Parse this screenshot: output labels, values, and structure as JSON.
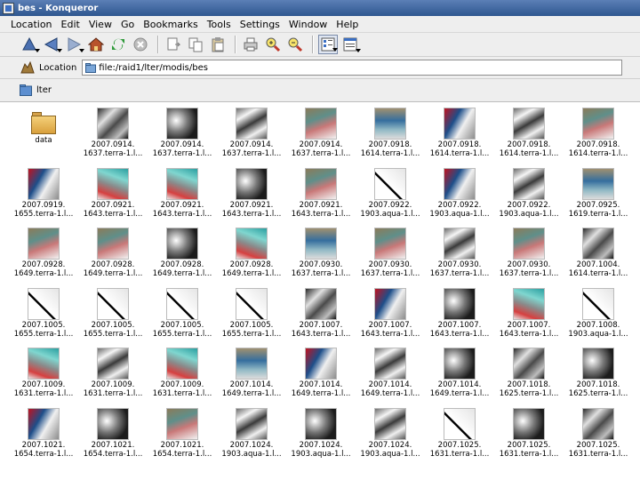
{
  "window": {
    "title": "bes - Konqueror"
  },
  "menu": [
    "Location",
    "Edit",
    "View",
    "Go",
    "Bookmarks",
    "Tools",
    "Settings",
    "Window",
    "Help"
  ],
  "toolbar": {
    "icons": [
      "up-icon",
      "back-icon",
      "forward-icon",
      "home-icon",
      "reload-icon",
      "stop-icon",
      "cut-icon",
      "copy-icon",
      "paste-icon",
      "print-icon",
      "zoom-in-icon",
      "zoom-out-icon",
      "icon-view-icon",
      "detail-view-icon"
    ]
  },
  "location": {
    "label": "Location",
    "url": "file:/raid1/lter/modis/bes"
  },
  "bookmarks": {
    "label": "lter"
  },
  "files": [
    {
      "l1": "data",
      "l2": "",
      "t": "folder"
    },
    {
      "l1": "2007.0914.",
      "l2": "1637.terra-1.l...",
      "t": "t-a"
    },
    {
      "l1": "2007.0914.",
      "l2": "1637.terra-1.l...",
      "t": "t-b"
    },
    {
      "l1": "2007.0914.",
      "l2": "1637.terra-1.l...",
      "t": "t-g"
    },
    {
      "l1": "2007.0914.",
      "l2": "1637.terra-1.l...",
      "t": "t-c"
    },
    {
      "l1": "2007.0918.",
      "l2": "1614.terra-1.l...",
      "t": "t-h"
    },
    {
      "l1": "2007.0918.",
      "l2": "1614.terra-1.l...",
      "t": "t-e"
    },
    {
      "l1": "2007.0918.",
      "l2": "1614.terra-1.l...",
      "t": "t-g"
    },
    {
      "l1": "2007.0918.",
      "l2": "1614.terra-1.l...",
      "t": "t-c"
    },
    {
      "l1": "2007.0919.",
      "l2": "1655.terra-1.l...",
      "t": "t-e"
    },
    {
      "l1": "2007.0921.",
      "l2": "1643.terra-1.l...",
      "t": "t-d"
    },
    {
      "l1": "2007.0921.",
      "l2": "1643.terra-1.l...",
      "t": "t-d"
    },
    {
      "l1": "2007.0921.",
      "l2": "1643.terra-1.l...",
      "t": "t-b"
    },
    {
      "l1": "2007.0921.",
      "l2": "1643.terra-1.l...",
      "t": "t-c"
    },
    {
      "l1": "2007.0922.",
      "l2": "1903.aqua-1.l...",
      "t": "t-f"
    },
    {
      "l1": "2007.0922.",
      "l2": "1903.aqua-1.l...",
      "t": "t-e"
    },
    {
      "l1": "2007.0922.",
      "l2": "1903.aqua-1.l...",
      "t": "t-g"
    },
    {
      "l1": "2007.0925.",
      "l2": "1619.terra-1.l...",
      "t": "t-h"
    },
    {
      "l1": "2007.0928.",
      "l2": "1649.terra-1.l...",
      "t": "t-c"
    },
    {
      "l1": "2007.0928.",
      "l2": "1649.terra-1.l...",
      "t": "t-c"
    },
    {
      "l1": "2007.0928.",
      "l2": "1649.terra-1.l...",
      "t": "t-b"
    },
    {
      "l1": "2007.0928.",
      "l2": "1649.terra-1.l...",
      "t": "t-d"
    },
    {
      "l1": "2007.0930.",
      "l2": "1637.terra-1.l...",
      "t": "t-h"
    },
    {
      "l1": "2007.0930.",
      "l2": "1637.terra-1.l...",
      "t": "t-c"
    },
    {
      "l1": "2007.0930.",
      "l2": "1637.terra-1.l...",
      "t": "t-g"
    },
    {
      "l1": "2007.0930.",
      "l2": "1637.terra-1.l...",
      "t": "t-c"
    },
    {
      "l1": "2007.1004.",
      "l2": "1614.terra-1.l...",
      "t": "t-a"
    },
    {
      "l1": "2007.1005.",
      "l2": "1655.terra-1.l...",
      "t": "t-f"
    },
    {
      "l1": "2007.1005.",
      "l2": "1655.terra-1.l...",
      "t": "t-f"
    },
    {
      "l1": "2007.1005.",
      "l2": "1655.terra-1.l...",
      "t": "t-f"
    },
    {
      "l1": "2007.1005.",
      "l2": "1655.terra-1.l...",
      "t": "t-f"
    },
    {
      "l1": "2007.1007.",
      "l2": "1643.terra-1.l...",
      "t": "t-a"
    },
    {
      "l1": "2007.1007.",
      "l2": "1643.terra-1.l...",
      "t": "t-e"
    },
    {
      "l1": "2007.1007.",
      "l2": "1643.terra-1.l...",
      "t": "t-b"
    },
    {
      "l1": "2007.1007.",
      "l2": "1643.terra-1.l...",
      "t": "t-d"
    },
    {
      "l1": "2007.1008.",
      "l2": "1903.aqua-1.l...",
      "t": "t-f"
    },
    {
      "l1": "2007.1009.",
      "l2": "1631.terra-1.l...",
      "t": "t-d"
    },
    {
      "l1": "2007.1009.",
      "l2": "1631.terra-1.l...",
      "t": "t-g"
    },
    {
      "l1": "2007.1009.",
      "l2": "1631.terra-1.l...",
      "t": "t-d"
    },
    {
      "l1": "2007.1014.",
      "l2": "1649.terra-1.l...",
      "t": "t-h"
    },
    {
      "l1": "2007.1014.",
      "l2": "1649.terra-1.l...",
      "t": "t-e"
    },
    {
      "l1": "2007.1014.",
      "l2": "1649.terra-1.l...",
      "t": "t-g"
    },
    {
      "l1": "2007.1014.",
      "l2": "1649.terra-1.l...",
      "t": "t-b"
    },
    {
      "l1": "2007.1018.",
      "l2": "1625.terra-1.l...",
      "t": "t-a"
    },
    {
      "l1": "2007.1018.",
      "l2": "1625.terra-1.l...",
      "t": "t-b"
    },
    {
      "l1": "2007.1021.",
      "l2": "1654.terra-1.l...",
      "t": "t-e"
    },
    {
      "l1": "2007.1021.",
      "l2": "1654.terra-1.l...",
      "t": "t-b"
    },
    {
      "l1": "2007.1021.",
      "l2": "1654.terra-1.l...",
      "t": "t-c"
    },
    {
      "l1": "2007.1024.",
      "l2": "1903.aqua-1.l...",
      "t": "t-g"
    },
    {
      "l1": "2007.1024.",
      "l2": "1903.aqua-1.l...",
      "t": "t-b"
    },
    {
      "l1": "2007.1024.",
      "l2": "1903.aqua-1.l...",
      "t": "t-g"
    },
    {
      "l1": "2007.1025.",
      "l2": "1631.terra-1.l...",
      "t": "t-f"
    },
    {
      "l1": "2007.1025.",
      "l2": "1631.terra-1.l...",
      "t": "t-b"
    },
    {
      "l1": "2007.1025.",
      "l2": "1631.terra-1.l...",
      "t": "t-a"
    }
  ]
}
